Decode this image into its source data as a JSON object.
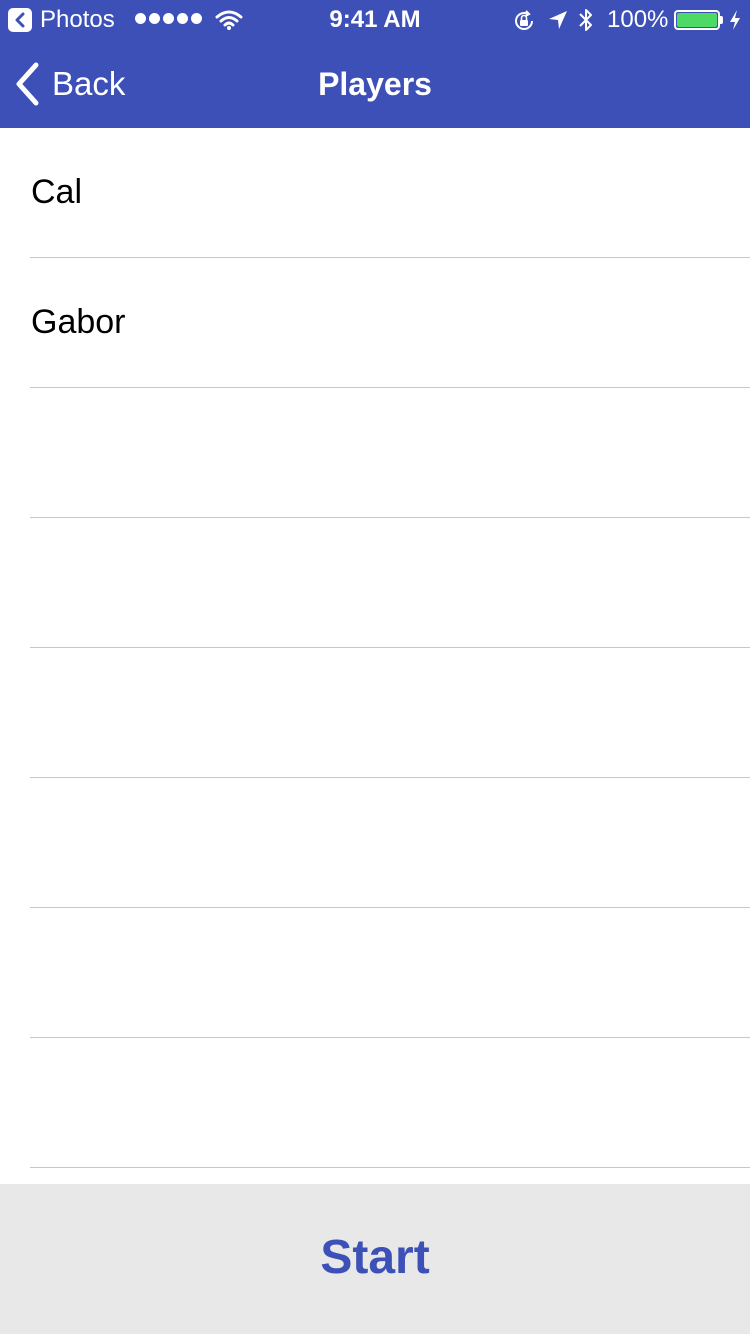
{
  "colors": {
    "accent": "#3d50b8",
    "battery_green": "#4cd964",
    "start_bar_bg": "#e8e8e8",
    "separator": "#c8c8cc"
  },
  "status_bar": {
    "back_app": "Photos",
    "signal_dots": 5,
    "time": "9:41 AM",
    "battery_percent_label": "100%",
    "battery_level": 1.0,
    "icons": [
      "back-app-icon",
      "signal-icon",
      "wifi-icon",
      "rotation-lock-icon",
      "location-icon",
      "bluetooth-icon",
      "battery-icon",
      "charging-bolt-icon"
    ]
  },
  "navbar": {
    "back_label": "Back",
    "title": "Players"
  },
  "players": [
    {
      "name": "Cal"
    },
    {
      "name": "Gabor"
    },
    {
      "name": ""
    },
    {
      "name": ""
    },
    {
      "name": ""
    },
    {
      "name": ""
    },
    {
      "name": ""
    },
    {
      "name": ""
    }
  ],
  "start_label": "Start"
}
